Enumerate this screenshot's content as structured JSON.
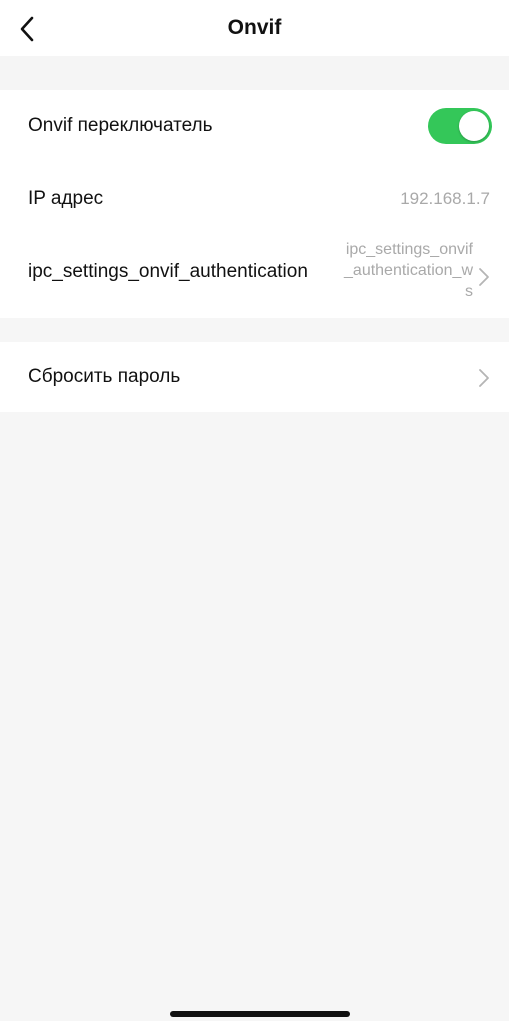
{
  "nav": {
    "title": "Onvif",
    "back_icon": "chevron-left-icon"
  },
  "settings": {
    "onvif_switch": {
      "label": "Onvif переключатель",
      "enabled": true,
      "toggle_color": "#34c759"
    },
    "ip_address": {
      "label": "IP адрес",
      "value": "192.168.1.7"
    },
    "authentication": {
      "label": "ipc_settings_onvif_authentication",
      "value": "ipc_settings_onvif_authentication_ws",
      "icon": "chevron-right-icon"
    }
  },
  "reset": {
    "label": "Сбросить пароль",
    "icon": "chevron-right-icon"
  }
}
